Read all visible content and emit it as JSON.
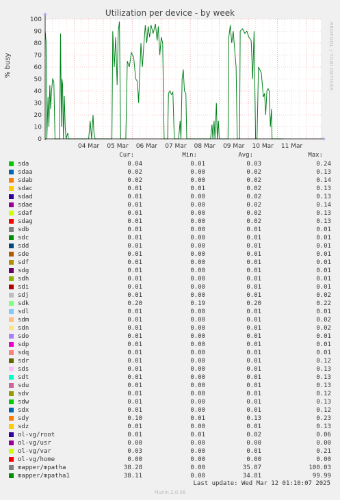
{
  "chart_data": {
    "type": "line",
    "title": "Utilization per device - by week",
    "ylabel": "% busy",
    "ylim": [
      0,
      100
    ],
    "yticks": [
      0,
      10,
      20,
      30,
      40,
      50,
      60,
      70,
      80,
      90,
      100
    ],
    "x_range": [
      "03 Mar 00:00",
      "12 Mar 12:00"
    ],
    "xtick_labels": [
      "04 Mar",
      "05 Mar",
      "06 Mar",
      "07 Mar",
      "08 Mar",
      "09 Mar",
      "10 Mar",
      "11 Mar"
    ],
    "grid": true,
    "series": [
      {
        "name": "mapper/mpatha1",
        "color": "#00801b",
        "points": [
          [
            0.0,
            90
          ],
          [
            0.03,
            82
          ],
          [
            0.06,
            0
          ],
          [
            0.1,
            35
          ],
          [
            0.13,
            10
          ],
          [
            0.16,
            45
          ],
          [
            0.19,
            25
          ],
          [
            0.22,
            40
          ],
          [
            0.26,
            50
          ],
          [
            0.3,
            48
          ],
          [
            0.34,
            0
          ],
          [
            0.5,
            0
          ],
          [
            0.53,
            88
          ],
          [
            0.56,
            10
          ],
          [
            0.58,
            50
          ],
          [
            0.6,
            45
          ],
          [
            0.63,
            0
          ],
          [
            0.66,
            36
          ],
          [
            0.69,
            10
          ],
          [
            0.72,
            0
          ],
          [
            0.78,
            5
          ],
          [
            0.8,
            0
          ],
          [
            1.5,
            0
          ],
          [
            1.55,
            15
          ],
          [
            1.6,
            0
          ],
          [
            1.65,
            20
          ],
          [
            1.68,
            5
          ],
          [
            1.72,
            0
          ],
          [
            2.3,
            0
          ],
          [
            2.33,
            90
          ],
          [
            2.38,
            60
          ],
          [
            2.43,
            85
          ],
          [
            2.48,
            45
          ],
          [
            2.52,
            90
          ],
          [
            2.56,
            98
          ],
          [
            2.6,
            0
          ],
          [
            2.78,
            0
          ],
          [
            2.83,
            65
          ],
          [
            2.9,
            60
          ],
          [
            2.97,
            72
          ],
          [
            3.05,
            68
          ],
          [
            3.12,
            50
          ],
          [
            3.18,
            48
          ],
          [
            3.22,
            30
          ],
          [
            3.26,
            55
          ],
          [
            3.3,
            80
          ],
          [
            3.35,
            60
          ],
          [
            3.4,
            78
          ],
          [
            3.45,
            95
          ],
          [
            3.5,
            80
          ],
          [
            3.55,
            94
          ],
          [
            3.6,
            85
          ],
          [
            3.65,
            95
          ],
          [
            3.72,
            88
          ],
          [
            3.8,
            96
          ],
          [
            3.86,
            82
          ],
          [
            3.9,
            94
          ],
          [
            3.95,
            70
          ],
          [
            4.0,
            85
          ],
          [
            4.05,
            80
          ],
          [
            4.1,
            0
          ],
          [
            4.22,
            0
          ],
          [
            4.25,
            38
          ],
          [
            4.3,
            40
          ],
          [
            4.35,
            37
          ],
          [
            4.4,
            39
          ],
          [
            4.45,
            0
          ],
          [
            4.6,
            0
          ],
          [
            4.65,
            15
          ],
          [
            4.68,
            0
          ],
          [
            4.72,
            50
          ],
          [
            4.76,
            58
          ],
          [
            4.8,
            40
          ],
          [
            4.85,
            38
          ],
          [
            4.88,
            0
          ],
          [
            5.7,
            0
          ],
          [
            5.75,
            12
          ],
          [
            5.78,
            0
          ],
          [
            5.82,
            15
          ],
          [
            5.85,
            0
          ],
          [
            5.9,
            30
          ],
          [
            5.93,
            0
          ],
          [
            5.97,
            15
          ],
          [
            6.0,
            0
          ],
          [
            6.3,
            0
          ],
          [
            6.33,
            85
          ],
          [
            6.38,
            95
          ],
          [
            6.43,
            80
          ],
          [
            6.48,
            90
          ],
          [
            6.53,
            75
          ],
          [
            6.58,
            60
          ],
          [
            6.62,
            0
          ],
          [
            6.7,
            0
          ],
          [
            6.72,
            90
          ],
          [
            6.8,
            92
          ],
          [
            6.88,
            88
          ],
          [
            6.95,
            90
          ],
          [
            7.02,
            85
          ],
          [
            7.1,
            82
          ],
          [
            7.15,
            50
          ],
          [
            7.2,
            90
          ],
          [
            7.25,
            0
          ],
          [
            7.3,
            0
          ],
          [
            7.35,
            60
          ],
          [
            7.45,
            55
          ],
          [
            7.52,
            35
          ],
          [
            7.56,
            38
          ],
          [
            7.6,
            20
          ],
          [
            7.64,
            40
          ],
          [
            7.68,
            42
          ],
          [
            7.72,
            40
          ],
          [
            7.76,
            10
          ],
          [
            7.8,
            25
          ],
          [
            7.82,
            0
          ],
          [
            8.2,
            0
          ]
        ]
      },
      {
        "name": "mapper/mpatha",
        "color": "#808080",
        "points": []
      }
    ]
  },
  "legend": {
    "headers": {
      "cur": "Cur:",
      "min": "Min:",
      "avg": "Avg:",
      "max": "Max:"
    },
    "rows": [
      {
        "name": "sda",
        "color": "#00cc00",
        "cur": "0.04",
        "min": "0.01",
        "avg": "0.03",
        "max": "0.24"
      },
      {
        "name": "sdaa",
        "color": "#0066b3",
        "cur": "0.02",
        "min": "0.00",
        "avg": "0.02",
        "max": "0.13"
      },
      {
        "name": "sdab",
        "color": "#ff8000",
        "cur": "0.02",
        "min": "0.00",
        "avg": "0.02",
        "max": "0.14"
      },
      {
        "name": "sdac",
        "color": "#ffcc00",
        "cur": "0.01",
        "min": "0.01",
        "avg": "0.02",
        "max": "0.13"
      },
      {
        "name": "sdad",
        "color": "#330099",
        "cur": "0.01",
        "min": "0.00",
        "avg": "0.02",
        "max": "0.13"
      },
      {
        "name": "sdae",
        "color": "#990099",
        "cur": "0.01",
        "min": "0.00",
        "avg": "0.02",
        "max": "0.14"
      },
      {
        "name": "sdaf",
        "color": "#ccff00",
        "cur": "0.01",
        "min": "0.00",
        "avg": "0.02",
        "max": "0.13"
      },
      {
        "name": "sdag",
        "color": "#ff0000",
        "cur": "0.01",
        "min": "0.00",
        "avg": "0.02",
        "max": "0.13"
      },
      {
        "name": "sdb",
        "color": "#808080",
        "cur": "0.01",
        "min": "0.00",
        "avg": "0.01",
        "max": "0.01"
      },
      {
        "name": "sdc",
        "color": "#008f00",
        "cur": "0.01",
        "min": "0.00",
        "avg": "0.01",
        "max": "0.01"
      },
      {
        "name": "sdd",
        "color": "#00487d",
        "cur": "0.01",
        "min": "0.00",
        "avg": "0.01",
        "max": "0.01"
      },
      {
        "name": "sde",
        "color": "#b35a00",
        "cur": "0.01",
        "min": "0.00",
        "avg": "0.01",
        "max": "0.01"
      },
      {
        "name": "sdf",
        "color": "#b38f00",
        "cur": "0.01",
        "min": "0.00",
        "avg": "0.01",
        "max": "0.01"
      },
      {
        "name": "sdg",
        "color": "#6b006b",
        "cur": "0.01",
        "min": "0.00",
        "avg": "0.01",
        "max": "0.01"
      },
      {
        "name": "sdh",
        "color": "#8fb300",
        "cur": "0.01",
        "min": "0.00",
        "avg": "0.01",
        "max": "0.01"
      },
      {
        "name": "sdi",
        "color": "#b30000",
        "cur": "0.01",
        "min": "0.00",
        "avg": "0.01",
        "max": "0.01"
      },
      {
        "name": "sdj",
        "color": "#bebebe",
        "cur": "0.01",
        "min": "0.00",
        "avg": "0.01",
        "max": "0.02"
      },
      {
        "name": "sdk",
        "color": "#80ff80",
        "cur": "0.20",
        "min": "0.19",
        "avg": "0.20",
        "max": "0.22"
      },
      {
        "name": "sdl",
        "color": "#80c9ff",
        "cur": "0.01",
        "min": "0.00",
        "avg": "0.01",
        "max": "0.01"
      },
      {
        "name": "sdm",
        "color": "#ffc080",
        "cur": "0.01",
        "min": "0.00",
        "avg": "0.01",
        "max": "0.02"
      },
      {
        "name": "sdn",
        "color": "#ffe680",
        "cur": "0.01",
        "min": "0.00",
        "avg": "0.01",
        "max": "0.02"
      },
      {
        "name": "sdo",
        "color": "#aa80ff",
        "cur": "0.01",
        "min": "0.00",
        "avg": "0.01",
        "max": "0.01"
      },
      {
        "name": "sdp",
        "color": "#ee00cc",
        "cur": "0.01",
        "min": "0.00",
        "avg": "0.01",
        "max": "0.01"
      },
      {
        "name": "sdq",
        "color": "#ff8080",
        "cur": "0.01",
        "min": "0.00",
        "avg": "0.01",
        "max": "0.01"
      },
      {
        "name": "sdr",
        "color": "#666600",
        "cur": "0.01",
        "min": "0.00",
        "avg": "0.01",
        "max": "0.12"
      },
      {
        "name": "sds",
        "color": "#ffbfff",
        "cur": "0.01",
        "min": "0.00",
        "avg": "0.01",
        "max": "0.13"
      },
      {
        "name": "sdt",
        "color": "#00ffcc",
        "cur": "0.01",
        "min": "0.00",
        "avg": "0.01",
        "max": "0.13"
      },
      {
        "name": "sdu",
        "color": "#cc6699",
        "cur": "0.01",
        "min": "0.00",
        "avg": "0.01",
        "max": "0.13"
      },
      {
        "name": "sdv",
        "color": "#999900",
        "cur": "0.01",
        "min": "0.00",
        "avg": "0.01",
        "max": "0.12"
      },
      {
        "name": "sdw",
        "color": "#00cc00",
        "cur": "0.01",
        "min": "0.00",
        "avg": "0.01",
        "max": "0.13"
      },
      {
        "name": "sdx",
        "color": "#0066b3",
        "cur": "0.01",
        "min": "0.00",
        "avg": "0.01",
        "max": "0.12"
      },
      {
        "name": "sdy",
        "color": "#ff8000",
        "cur": "0.10",
        "min": "0.01",
        "avg": "0.13",
        "max": "0.23"
      },
      {
        "name": "sdz",
        "color": "#ffcc00",
        "cur": "0.01",
        "min": "0.00",
        "avg": "0.01",
        "max": "0.13"
      },
      {
        "name": "ol-vg/root",
        "color": "#330099",
        "cur": "0.01",
        "min": "0.01",
        "avg": "0.02",
        "max": "0.06"
      },
      {
        "name": "ol-vg/usr",
        "color": "#990099",
        "cur": "0.00",
        "min": "0.00",
        "avg": "0.00",
        "max": "0.00"
      },
      {
        "name": "ol-vg/var",
        "color": "#ccff00",
        "cur": "0.03",
        "min": "0.00",
        "avg": "0.01",
        "max": "0.21"
      },
      {
        "name": "ol-vg/home",
        "color": "#ff0000",
        "cur": "0.00",
        "min": "0.00",
        "avg": "0.00",
        "max": "0.00"
      },
      {
        "name": "mapper/mpatha",
        "color": "#808080",
        "cur": "38.28",
        "min": "0.00",
        "avg": "35.07",
        "max": "100.03"
      },
      {
        "name": "mapper/mpatha1",
        "color": "#008f00",
        "cur": "38.11",
        "min": "0.00",
        "avg": "34.81",
        "max": "99.99"
      }
    ]
  },
  "watermark": "RRDTOOL / TOBI OETIKER",
  "last_update": "Last update: Wed Mar 12 01:10:07 2025",
  "footer": "Munin 2.0.56"
}
